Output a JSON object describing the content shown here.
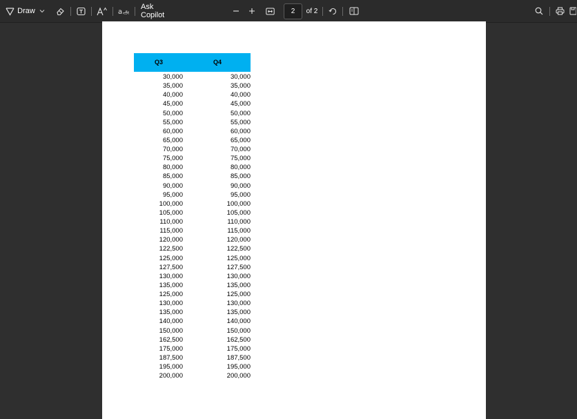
{
  "toolbar": {
    "draw_label": "Draw",
    "copilot_label": "Ask Copilot",
    "page_current": "2",
    "page_of": "of 2",
    "icons": [
      "draw-icon",
      "chevron-down-icon",
      "eraser-icon",
      "text-box-icon",
      "text-size-icon",
      "translate-icon",
      "zoom-out-icon",
      "zoom-in-icon",
      "fit-page-icon",
      "rotate-icon",
      "page-view-icon",
      "search-icon",
      "print-icon",
      "save-icon"
    ]
  },
  "table": {
    "headers": [
      "Q3",
      "Q4"
    ],
    "header_color": "#00b0f0",
    "rows": [
      [
        "30,000",
        "30,000"
      ],
      [
        "35,000",
        "35,000"
      ],
      [
        "40,000",
        "40,000"
      ],
      [
        "45,000",
        "45,000"
      ],
      [
        "50,000",
        "50,000"
      ],
      [
        "55,000",
        "55,000"
      ],
      [
        "60,000",
        "60,000"
      ],
      [
        "65,000",
        "65,000"
      ],
      [
        "70,000",
        "70,000"
      ],
      [
        "75,000",
        "75,000"
      ],
      [
        "80,000",
        "80,000"
      ],
      [
        "85,000",
        "85,000"
      ],
      [
        "90,000",
        "90,000"
      ],
      [
        "95,000",
        "95,000"
      ],
      [
        "100,000",
        "100,000"
      ],
      [
        "105,000",
        "105,000"
      ],
      [
        "110,000",
        "110,000"
      ],
      [
        "115,000",
        "115,000"
      ],
      [
        "120,000",
        "120,000"
      ],
      [
        "122,500",
        "122,500"
      ],
      [
        "125,000",
        "125,000"
      ],
      [
        "127,500",
        "127,500"
      ],
      [
        "130,000",
        "130,000"
      ],
      [
        "135,000",
        "135,000"
      ],
      [
        "125,000",
        "125,000"
      ],
      [
        "130,000",
        "130,000"
      ],
      [
        "135,000",
        "135,000"
      ],
      [
        "140,000",
        "140,000"
      ],
      [
        "150,000",
        "150,000"
      ],
      [
        "162,500",
        "162,500"
      ],
      [
        "175,000",
        "175,000"
      ],
      [
        "187,500",
        "187,500"
      ],
      [
        "195,000",
        "195,000"
      ],
      [
        "200,000",
        "200,000"
      ]
    ]
  }
}
